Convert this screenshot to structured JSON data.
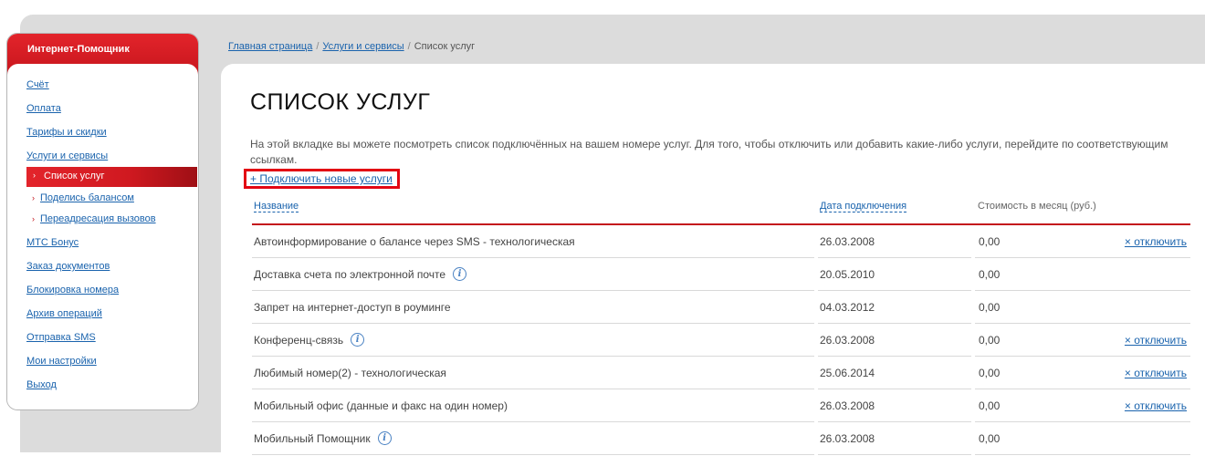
{
  "sidebar": {
    "title": "Интернет-Помощник",
    "items": [
      {
        "label": "Счёт"
      },
      {
        "label": "Оплата"
      },
      {
        "label": "Тарифы и скидки"
      },
      {
        "label": "Услуги и сервисы"
      },
      {
        "label": "Список услуг"
      },
      {
        "label": "Поделись балансом"
      },
      {
        "label": "Переадресация вызовов"
      },
      {
        "label": "МТС Бонус"
      },
      {
        "label": "Заказ документов"
      },
      {
        "label": "Блокировка номера"
      },
      {
        "label": "Архив операций"
      },
      {
        "label": "Отправка SMS"
      },
      {
        "label": "Мои настройки"
      },
      {
        "label": "Выход"
      }
    ],
    "arrow": "›"
  },
  "breadcrumb": {
    "home": "Главная страница",
    "services": "Услуги и сервисы",
    "current": "Список услуг",
    "sep": "/"
  },
  "main": {
    "title": "СПИСОК УСЛУГ",
    "intro": "На этой вкладке вы можете посмотреть список подключённых на вашем номере услуг. Для того, чтобы отключить или добавить какие-либо услуги, перейдите по соответствующим ссылкам.",
    "add_link": "+ Подключить новые услуги"
  },
  "table": {
    "columns": {
      "name": "Название",
      "date": "Дата подключения",
      "cost": "Стоимость в месяц (руб.)"
    },
    "disconnect_label": "× отключить",
    "rows": [
      {
        "name": "Автоинформирование о балансе через SMS - технологическая",
        "date": "26.03.2008",
        "cost": "0,00",
        "info": false,
        "disconnect": true
      },
      {
        "name": "Доставка счета по электронной почте",
        "date": "20.05.2010",
        "cost": "0,00",
        "info": true,
        "disconnect": false
      },
      {
        "name": "Запрет на интернет-доступ в роуминге",
        "date": "04.03.2012",
        "cost": "0,00",
        "info": false,
        "disconnect": false
      },
      {
        "name": "Конференц-связь",
        "date": "26.03.2008",
        "cost": "0,00",
        "info": true,
        "disconnect": true
      },
      {
        "name": "Любимый номер(2) - технологическая",
        "date": "25.06.2014",
        "cost": "0,00",
        "info": false,
        "disconnect": true
      },
      {
        "name": "Мобильный офис (данные и факс на один номер)",
        "date": "26.03.2008",
        "cost": "0,00",
        "info": false,
        "disconnect": true
      },
      {
        "name": "Мобильный Помощник",
        "date": "26.03.2008",
        "cost": "0,00",
        "info": true,
        "disconnect": false
      }
    ]
  },
  "icons": {
    "info": "i"
  },
  "colors": {
    "brand_red": "#c4141b",
    "link_blue": "#1a63ad",
    "highlight_box": "#e30613"
  }
}
